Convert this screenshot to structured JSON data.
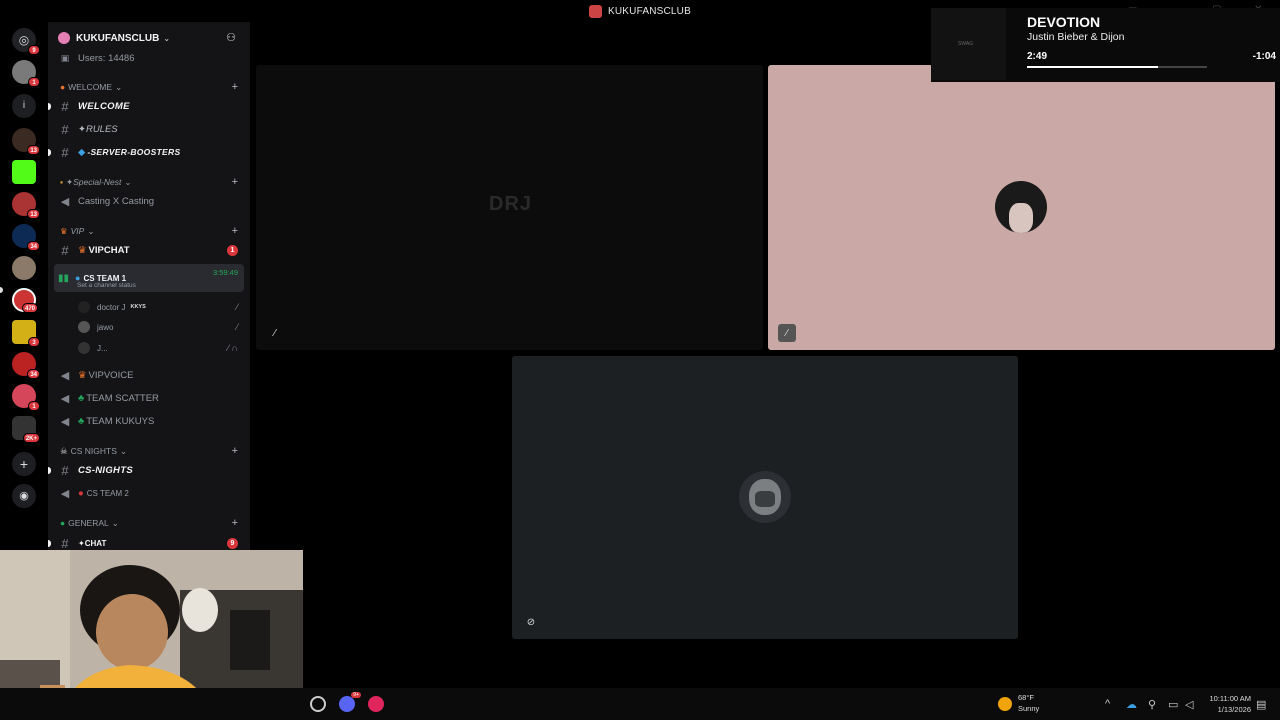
{
  "window": {
    "title": "KUKUFANSCLUB"
  },
  "server": {
    "name": "KUKUFANSCLUB",
    "users_label": "Users: 14486"
  },
  "rail": {
    "badges": [
      "9",
      "1",
      "13",
      "13",
      "34",
      "470",
      "3",
      "34",
      "1",
      "2K+"
    ]
  },
  "channels": {
    "cat_welcome": "WELCOME",
    "welcome": "WELCOME",
    "rules": "✦RULES",
    "boosters": "-SERVER-BOOSTERS",
    "cat_special": "✦Special-Nest",
    "casting": "Casting X Casting",
    "cat_vip": "VIP",
    "vipchat": "VIPCHAT",
    "vipchat_mentions": "1",
    "cs_team1": "CS TEAM 1",
    "cs_team1_timer": "3:59:49",
    "cs_team1_status": "Set a channel status",
    "voice_users": [
      {
        "name": "doctor J",
        "tag": "KKYS"
      },
      {
        "name": "jawo",
        "tag": ""
      },
      {
        "name": "J...",
        "tag": ""
      }
    ],
    "vipvoice": "VIPVOICE",
    "team_scatter": "TEAM SCATTER",
    "team_kukuys": "TEAM KUKUYS",
    "cat_cs_nights": "CS NIGHTS",
    "cs_nights": "CS-NIGHTS",
    "cs_team2": "CS TEAM 2",
    "cat_general": "GENERAL",
    "chat": "✦CHAT",
    "chat_mentions": "9"
  },
  "tiles": {
    "drj_label": "DRJ"
  },
  "now_playing": {
    "title": "DEVOTION",
    "artist": "Justin Bieber & Dijon",
    "elapsed": "2:49",
    "remaining": "-1:04",
    "progress": 0.73,
    "art_label": "SWAG"
  },
  "taskbar": {
    "discord_badge": "9+",
    "temperature": "68°F",
    "condition": "Sunny",
    "time": "10:11:00 AM",
    "date": "1/13/2026"
  },
  "colors": {
    "accent_red": "#da373c",
    "voice_green": "#23a55a",
    "pink_tile": "#c9a8a6",
    "dark_tile": "#1d2022"
  }
}
